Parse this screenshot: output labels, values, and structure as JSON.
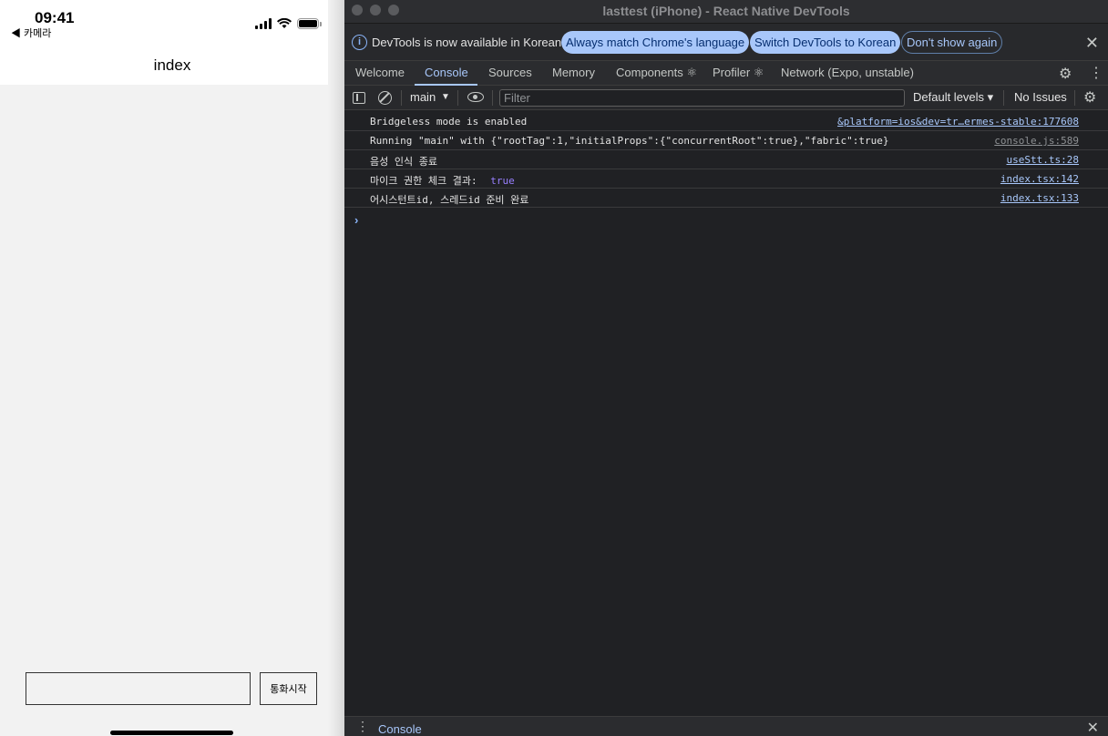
{
  "phone": {
    "status_time": "09:41",
    "back_label": "◀ 카메라",
    "nav_title": "index",
    "input_value": "",
    "call_button_label": "통화시작"
  },
  "devtools": {
    "window_title": "lasttest (iPhone) - React Native DevTools",
    "infobar": {
      "message": "DevTools is now available in Korean!",
      "match_language_label": "Always match Chrome's language",
      "switch_language_label": "Switch DevTools to Korean",
      "dont_show_label": "Don't show again"
    },
    "tabs": [
      {
        "label": "Welcome"
      },
      {
        "label": "Console"
      },
      {
        "label": "Sources"
      },
      {
        "label": "Memory"
      },
      {
        "label": "Components ⚛"
      },
      {
        "label": "Profiler ⚛"
      },
      {
        "label": "Network (Expo, unstable)"
      }
    ],
    "toolbar": {
      "context": "main",
      "filter_placeholder": "Filter",
      "levels": "Default levels ▾",
      "issues": "No Issues"
    },
    "console_messages": [
      {
        "text": "Bridgeless mode is enabled",
        "source": "&platform=ios&dev=tr…ermes-stable:177608"
      },
      {
        "text": "Running \"main\" with {\"rootTag\":1,\"initialProps\":{\"concurrentRoot\":true},\"fabric\":true}",
        "source": "console.js:589"
      },
      {
        "text": "음성 인식 종료",
        "source": "useStt.ts:28"
      },
      {
        "text": "마이크 권한 체크 결과: ",
        "value": "true",
        "source": "index.tsx:142"
      },
      {
        "text": "어시스턴트id, 스레드id 준비 완료",
        "source": "index.tsx:133"
      }
    ],
    "prompt_symbol": "›",
    "drawer_label": "Console"
  },
  "colors": {
    "accent": "#a8c7fa",
    "background": "#202124",
    "boolean": "#9980ff"
  }
}
